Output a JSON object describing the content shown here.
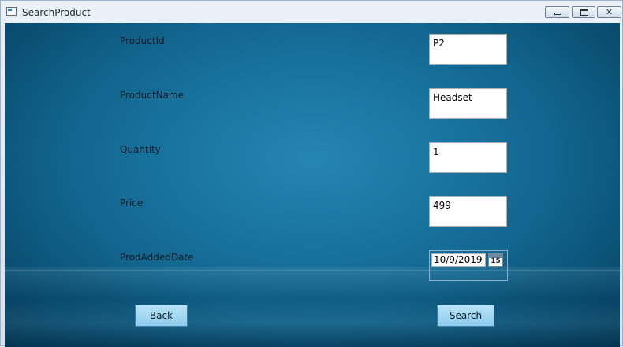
{
  "window": {
    "title": "SearchProduct",
    "controls": {
      "minimize": "minimize",
      "maximize": "maximize",
      "close": "✕"
    }
  },
  "form": {
    "fields": [
      {
        "label": "ProductId",
        "value": "P2"
      },
      {
        "label": "ProductName",
        "value": "Headset"
      },
      {
        "label": "Quantity",
        "value": "1"
      },
      {
        "label": "Price",
        "value": "499"
      }
    ],
    "date_field": {
      "label": "ProdAddedDate",
      "value": "10/9/2019",
      "calendar_day": "15"
    }
  },
  "buttons": {
    "back": "Back",
    "search": "Search"
  },
  "colors": {
    "background": "#1a75a2",
    "button": "#a6d9f2"
  }
}
